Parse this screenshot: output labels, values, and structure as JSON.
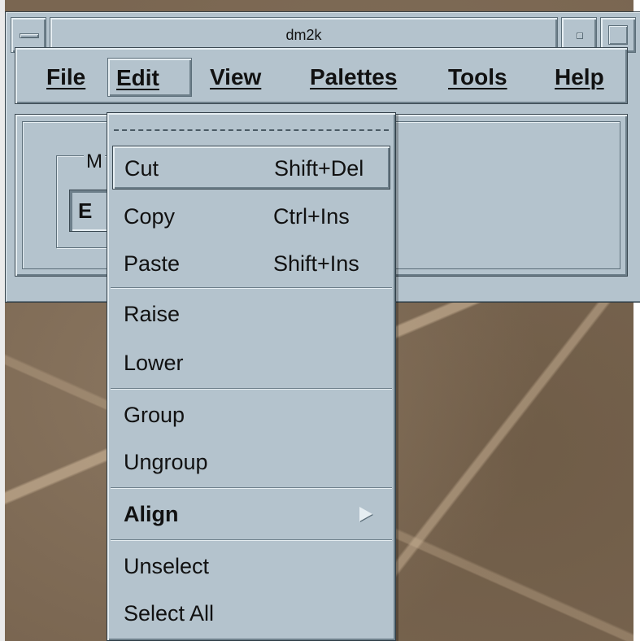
{
  "window": {
    "title": "dm2k"
  },
  "menubar": {
    "items": [
      {
        "label": "File",
        "mnemonic_index": 0
      },
      {
        "label": "Edit",
        "mnemonic_index": 0
      },
      {
        "label": "View",
        "mnemonic_index": 0
      },
      {
        "label": "Palettes",
        "mnemonic_index": 0
      },
      {
        "label": "Tools",
        "mnemonic_index": 0
      },
      {
        "label": "Help",
        "mnemonic_index": 0
      }
    ],
    "active": "Edit"
  },
  "workarea": {
    "group_label": "M",
    "mode_value": "E"
  },
  "edit_menu": {
    "items": [
      {
        "label": "Cut",
        "accelerator": "Shift+Del",
        "highlighted": true
      },
      {
        "label": "Copy",
        "accelerator": "Ctrl+Ins"
      },
      {
        "label": "Paste",
        "accelerator": "Shift+Ins"
      },
      {
        "label": "Raise"
      },
      {
        "label": "Lower"
      },
      {
        "label": "Group"
      },
      {
        "label": "Ungroup"
      },
      {
        "label": "Align",
        "submenu": true
      },
      {
        "label": "Unselect"
      },
      {
        "label": "Select All"
      }
    ]
  },
  "icons": {
    "window_menu": "window-menu-icon",
    "minimize": "minimize-icon",
    "maximize": "maximize-icon",
    "submenu_arrow": "submenu-arrow-icon"
  },
  "colors": {
    "motif_bg": "#b4c3cd"
  }
}
